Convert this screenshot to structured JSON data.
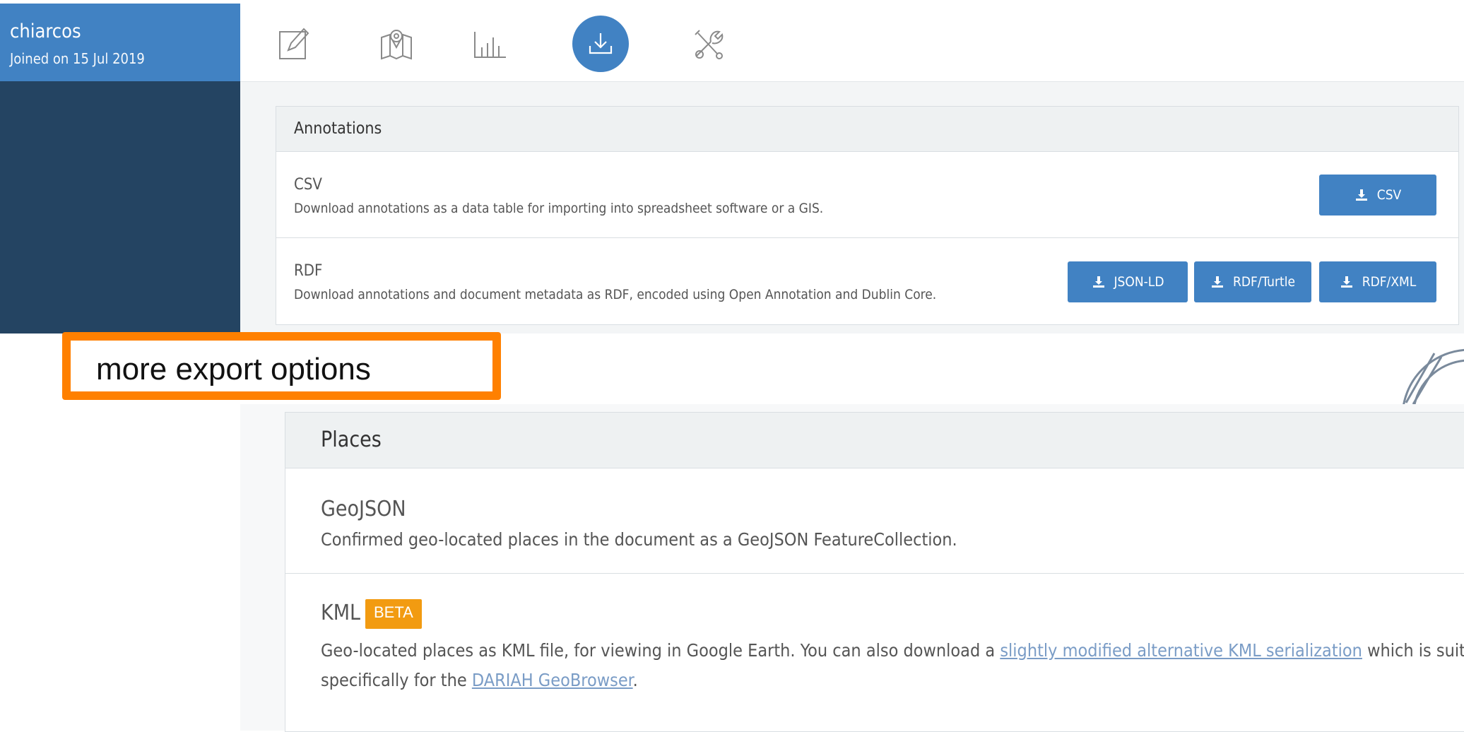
{
  "user": {
    "name": "chiarcos",
    "joined": "Joined on 15 Jul 2019"
  },
  "nav": [
    {
      "icon": "edit-icon"
    },
    {
      "icon": "map-icon"
    },
    {
      "icon": "stats-icon"
    },
    {
      "icon": "download-icon",
      "active": true
    },
    {
      "icon": "settings-icon"
    }
  ],
  "annotations": {
    "heading": "Annotations",
    "csv": {
      "title": "CSV",
      "description": "Download annotations as a data table for importing into spreadsheet software or a GIS.",
      "button": "CSV"
    },
    "rdf": {
      "title": "RDF",
      "description": "Download annotations and document metadata as RDF, encoded using Open Annotation and Dublin Core.",
      "buttons": [
        "JSON-LD",
        "RDF/Turtle",
        "RDF/XML"
      ]
    }
  },
  "callout": "more export options",
  "places": {
    "heading": "Places",
    "geojson": {
      "title": "GeoJSON",
      "description": "Confirmed geo-located places in the document as a GeoJSON FeatureCollection."
    },
    "kml": {
      "title": "KML",
      "badge": "BETA",
      "desc_part1": "Geo-located places as KML file, for viewing in Google Earth. You can also download a ",
      "link1": "slightly modified alternative KML serialization",
      "desc_part2": " which is suited",
      "desc_line2_prefix": "specifically for the ",
      "link2": "DARIAH GeoBrowser",
      "desc_line2_suffix": "."
    }
  },
  "colors": {
    "primary": "#4182c3",
    "sidebar": "#244462",
    "callout": "#ff8000",
    "badge": "#f29b11"
  }
}
